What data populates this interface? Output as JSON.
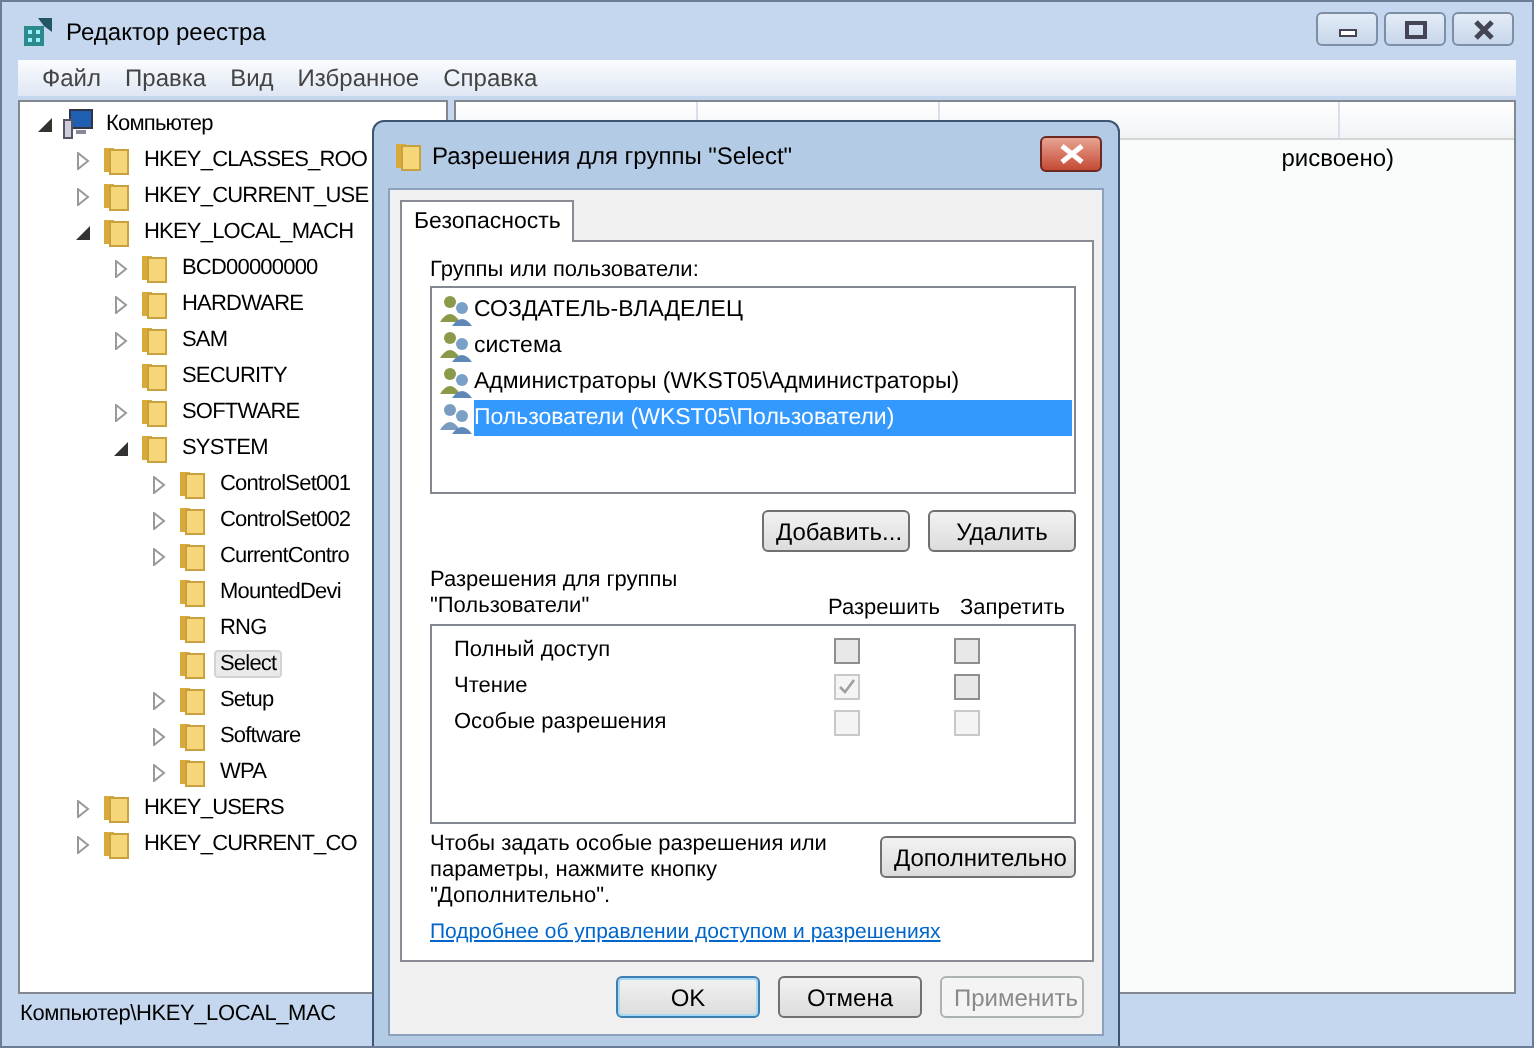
{
  "window": {
    "title": "Редактор реестра"
  },
  "menu": [
    "Файл",
    "Правка",
    "Вид",
    "Избранное",
    "Справка"
  ],
  "tree": [
    {
      "label": "Компьютер",
      "kind": "branch",
      "expanded": true,
      "selected": false,
      "children": [
        {
          "label": "HKEY_CLASSES_ROO",
          "kind": "branch",
          "expanded": false,
          "selected": false
        },
        {
          "label": "HKEY_CURRENT_USE",
          "kind": "branch",
          "expanded": false,
          "selected": false
        },
        {
          "label": "HKEY_LOCAL_MACH",
          "kind": "branch",
          "expanded": true,
          "selected": false,
          "children": [
            {
              "label": "BCD00000000",
              "kind": "branch",
              "expanded": false,
              "selected": false
            },
            {
              "label": "HARDWARE",
              "kind": "branch",
              "expanded": false,
              "selected": false
            },
            {
              "label": "SAM",
              "kind": "branch",
              "expanded": false,
              "selected": false
            },
            {
              "label": "SECURITY",
              "kind": "leaf",
              "selected": false
            },
            {
              "label": "SOFTWARE",
              "kind": "branch",
              "expanded": false,
              "selected": false
            },
            {
              "label": "SYSTEM",
              "kind": "branch",
              "expanded": true,
              "selected": false,
              "children": [
                {
                  "label": "ControlSet001",
                  "kind": "branch",
                  "expanded": false,
                  "selected": false
                },
                {
                  "label": "ControlSet002",
                  "kind": "branch",
                  "expanded": false,
                  "selected": false
                },
                {
                  "label": "CurrentContro",
                  "kind": "branch",
                  "expanded": false,
                  "selected": false
                },
                {
                  "label": "MountedDevi",
                  "kind": "leaf",
                  "selected": false
                },
                {
                  "label": "RNG",
                  "kind": "leaf",
                  "selected": false
                },
                {
                  "label": "Select",
                  "kind": "leaf",
                  "selected": true
                },
                {
                  "label": "Setup",
                  "kind": "branch",
                  "expanded": false,
                  "selected": false
                },
                {
                  "label": "Software",
                  "kind": "branch",
                  "expanded": false,
                  "selected": false
                },
                {
                  "label": "WPA",
                  "kind": "branch",
                  "expanded": false,
                  "selected": false
                }
              ]
            }
          ]
        },
        {
          "label": "HKEY_USERS",
          "kind": "branch",
          "expanded": false,
          "selected": false
        },
        {
          "label": "HKEY_CURRENT_CO",
          "kind": "branch",
          "expanded": false,
          "selected": false
        }
      ]
    }
  ],
  "values": {
    "rows": [
      {
        "column_3": "рисвоено)"
      }
    ]
  },
  "status_bar": "Компьютер\\HKEY_LOCAL_MAC",
  "dialog": {
    "title": "Разрешения для группы \"Select\"",
    "tabs": [
      {
        "label": "Безопасность",
        "selected": true
      }
    ],
    "groups_label": "Группы или пользователи:",
    "users": [
      {
        "label": "СОЗДАТЕЛЬ-ВЛАДЕЛЕЦ",
        "selected": false
      },
      {
        "label": "система",
        "selected": false
      },
      {
        "label": "Администраторы (WKST05\\Администраторы)",
        "selected": false
      },
      {
        "label": "Пользователи (WKST05\\Пользователи)",
        "selected": true
      }
    ],
    "user_buttons": [
      "Добавить...",
      "Удалить"
    ],
    "permissions_label": "Разрешения для группы \"Пользователи\"",
    "allow_header": "Разрешить",
    "deny_header": "Запретить",
    "permissions": [
      {
        "name": "Полный доступ",
        "allow": {
          "checked": false,
          "disabled": false
        },
        "deny": {
          "checked": false,
          "disabled": false
        }
      },
      {
        "name": "Чтение",
        "allow": {
          "checked": true,
          "disabled": true
        },
        "deny": {
          "checked": false,
          "disabled": false
        }
      },
      {
        "name": "Особые разрешения",
        "allow": {
          "checked": false,
          "disabled": true
        },
        "deny": {
          "checked": false,
          "disabled": true
        }
      }
    ],
    "advanced_hint": "Чтобы задать особые разрешения или параметры, нажмите кнопку \"Дополнительно\".",
    "advanced_button": "Дополнительно",
    "link": "Подробнее об управлении доступом и разрешениях",
    "buttons": [
      {
        "label": "OK",
        "default": true,
        "disabled": false
      },
      {
        "label": "Отмена",
        "default": false,
        "disabled": false
      },
      {
        "label": "Применить",
        "default": false,
        "disabled": true
      }
    ]
  }
}
